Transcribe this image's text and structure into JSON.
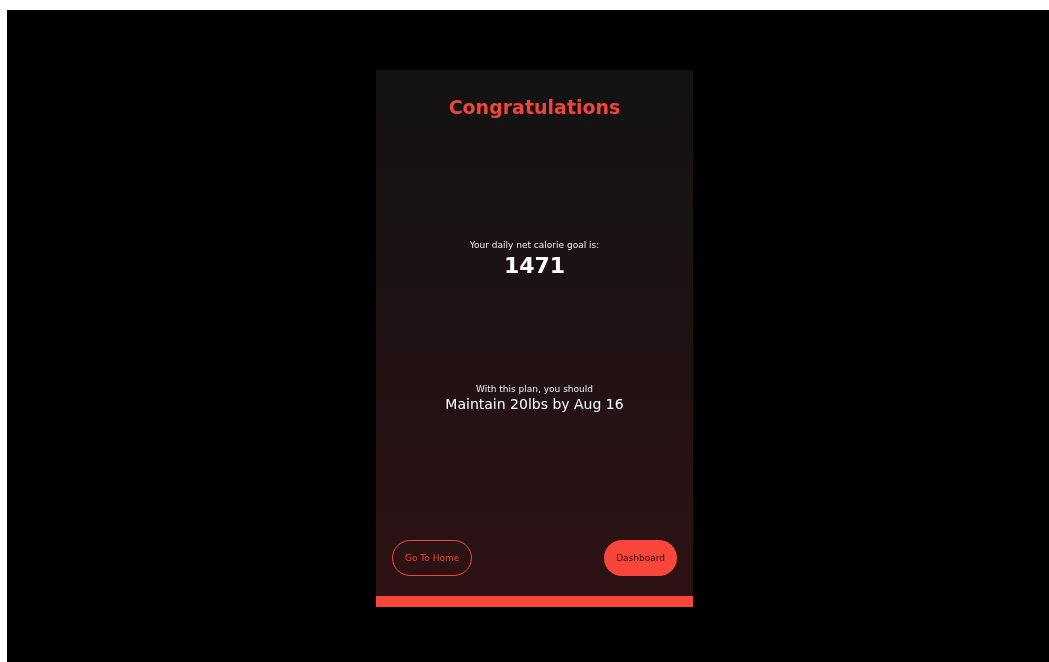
{
  "title": "Congratulations",
  "goal": {
    "label": "Your daily net calorie goal is:",
    "value": "1471"
  },
  "plan": {
    "label": "With this plan, you should",
    "value": "Maintain 20lbs by Aug 16"
  },
  "buttons": [
    {
      "label": "Go To Home",
      "kind": "outline"
    },
    {
      "label": "Dashboard",
      "kind": "filled"
    }
  ]
}
